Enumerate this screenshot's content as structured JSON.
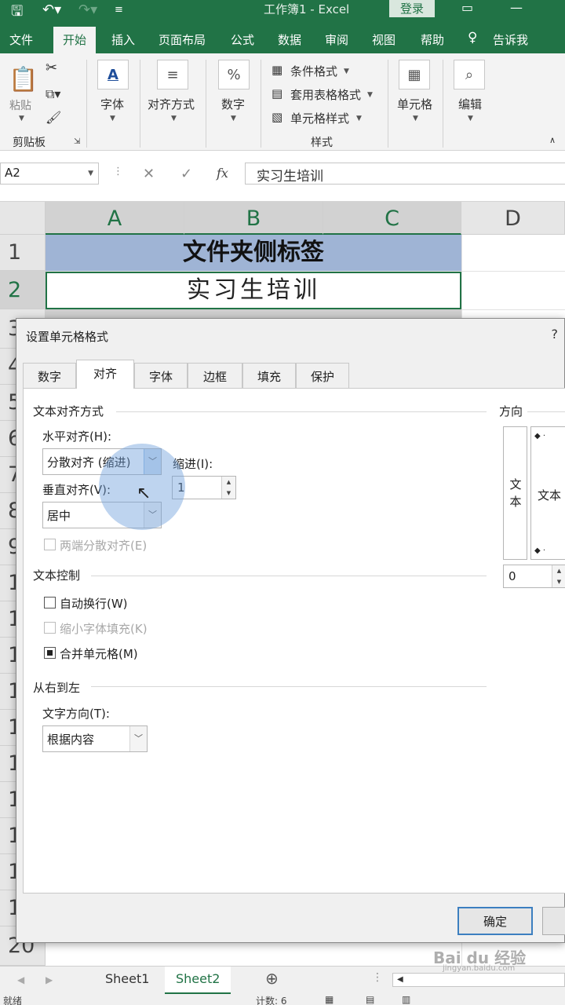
{
  "titlebar": {
    "title": "工作簿1 - Excel",
    "login": "登录"
  },
  "ribbon_tabs": [
    "文件",
    "开始",
    "插入",
    "页面布局",
    "公式",
    "数据",
    "审阅",
    "视图",
    "帮助",
    "告诉我"
  ],
  "ribbon": {
    "paste": "粘贴",
    "clipboard": "剪贴板",
    "font": "字体",
    "alignment": "对齐方式",
    "number": "数字",
    "conditional_format": "条件格式",
    "table_format": "套用表格格式",
    "cell_style": "单元格样式",
    "styles": "样式",
    "cells": "单元格",
    "editing": "编辑"
  },
  "formula_bar": {
    "name_box": "A2",
    "formula": "实习生培训"
  },
  "grid": {
    "columns": [
      "A",
      "B",
      "C",
      "D"
    ],
    "rows": [
      "1",
      "2",
      "3",
      "4",
      "5",
      "6",
      "7",
      "8",
      "9",
      "10",
      "11",
      "12",
      "13",
      "14",
      "15",
      "16",
      "17",
      "18",
      "19",
      "20"
    ],
    "a1": "文件夹侧标签",
    "a2": "实习生培训"
  },
  "dialog": {
    "title": "设置单元格格式",
    "help": "?",
    "tabs": [
      "数字",
      "对齐",
      "字体",
      "边框",
      "填充",
      "保护"
    ],
    "active_tab": "对齐",
    "text_alignment": {
      "section": "文本对齐方式",
      "horizontal_label": "水平对齐(H):",
      "horizontal_value": "分散对齐 (缩进)",
      "indent_label": "缩进(I):",
      "indent_value": "1",
      "vertical_label": "垂直对齐(V):",
      "vertical_value": "居中",
      "justify_distributed": "两端分散对齐(E)"
    },
    "text_control": {
      "section": "文本控制",
      "wrap_text": "自动换行(W)",
      "shrink_to_fit": "缩小字体填充(K)",
      "merge_cells": "合并单元格(M)",
      "merge_checked": true
    },
    "rtl": {
      "section": "从右到左",
      "direction_label": "文字方向(T):",
      "direction_value": "根据内容"
    },
    "orientation": {
      "section": "方向",
      "vertical_text": "文本",
      "text": "文本",
      "degrees": "0"
    },
    "ok": "确定"
  },
  "sheets": [
    "Sheet1",
    "Sheet2"
  ],
  "active_sheet": "Sheet2",
  "status": {
    "ready": "就绪",
    "count": "计数: 6"
  },
  "watermark": {
    "brand": "Bai du 经验",
    "url": "jingyan.baidu.com"
  },
  "colors": {
    "excel_green": "#217346",
    "header_fill": "#9fb4d5"
  }
}
